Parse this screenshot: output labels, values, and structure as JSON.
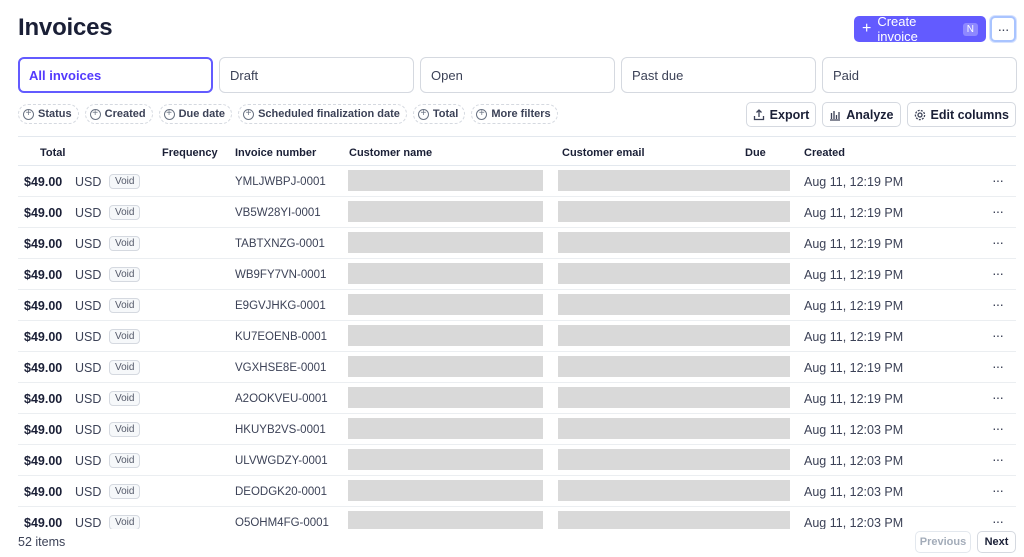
{
  "page": {
    "title": "Invoices"
  },
  "header": {
    "create_label": "Create invoice",
    "create_shortcut": "N",
    "more_label": "···"
  },
  "tabs": [
    {
      "label": "All invoices",
      "active": true
    },
    {
      "label": "Draft",
      "active": false
    },
    {
      "label": "Open",
      "active": false
    },
    {
      "label": "Past due",
      "active": false
    },
    {
      "label": "Paid",
      "active": false
    }
  ],
  "filters": [
    "Status",
    "Created",
    "Due date",
    "Scheduled finalization date",
    "Total",
    "More filters"
  ],
  "actions": {
    "export": "Export",
    "analyze": "Analyze",
    "edit_columns": "Edit columns"
  },
  "table": {
    "columns": {
      "total": "Total",
      "frequency": "Frequency",
      "invoice_number": "Invoice number",
      "customer_name": "Customer name",
      "customer_email": "Customer email",
      "due": "Due",
      "created": "Created"
    },
    "rows": [
      {
        "amount": "$49.00",
        "currency": "USD",
        "status": "Void",
        "invoice": "YMLJWBPJ-0001",
        "created": "Aug 11, 12:19 PM"
      },
      {
        "amount": "$49.00",
        "currency": "USD",
        "status": "Void",
        "invoice": "VB5W28YI-0001",
        "created": "Aug 11, 12:19 PM"
      },
      {
        "amount": "$49.00",
        "currency": "USD",
        "status": "Void",
        "invoice": "TABTXNZG-0001",
        "created": "Aug 11, 12:19 PM"
      },
      {
        "amount": "$49.00",
        "currency": "USD",
        "status": "Void",
        "invoice": "WB9FY7VN-0001",
        "created": "Aug 11, 12:19 PM"
      },
      {
        "amount": "$49.00",
        "currency": "USD",
        "status": "Void",
        "invoice": "E9GVJHKG-0001",
        "created": "Aug 11, 12:19 PM"
      },
      {
        "amount": "$49.00",
        "currency": "USD",
        "status": "Void",
        "invoice": "KU7EOENB-0001",
        "created": "Aug 11, 12:19 PM"
      },
      {
        "amount": "$49.00",
        "currency": "USD",
        "status": "Void",
        "invoice": "VGXHSE8E-0001",
        "created": "Aug 11, 12:19 PM"
      },
      {
        "amount": "$49.00",
        "currency": "USD",
        "status": "Void",
        "invoice": "A2OOKVEU-0001",
        "created": "Aug 11, 12:19 PM"
      },
      {
        "amount": "$49.00",
        "currency": "USD",
        "status": "Void",
        "invoice": "HKUYB2VS-0001",
        "created": "Aug 11, 12:03 PM"
      },
      {
        "amount": "$49.00",
        "currency": "USD",
        "status": "Void",
        "invoice": "ULVWGDZY-0001",
        "created": "Aug 11, 12:03 PM"
      },
      {
        "amount": "$49.00",
        "currency": "USD",
        "status": "Void",
        "invoice": "DEODGK20-0001",
        "created": "Aug 11, 12:03 PM"
      },
      {
        "amount": "$49.00",
        "currency": "USD",
        "status": "Void",
        "invoice": "O5OHM4FG-0001",
        "created": "Aug 11, 12:03 PM"
      }
    ],
    "row_menu": "···"
  },
  "footer": {
    "count": "52 items",
    "previous": "Previous",
    "next": "Next"
  }
}
